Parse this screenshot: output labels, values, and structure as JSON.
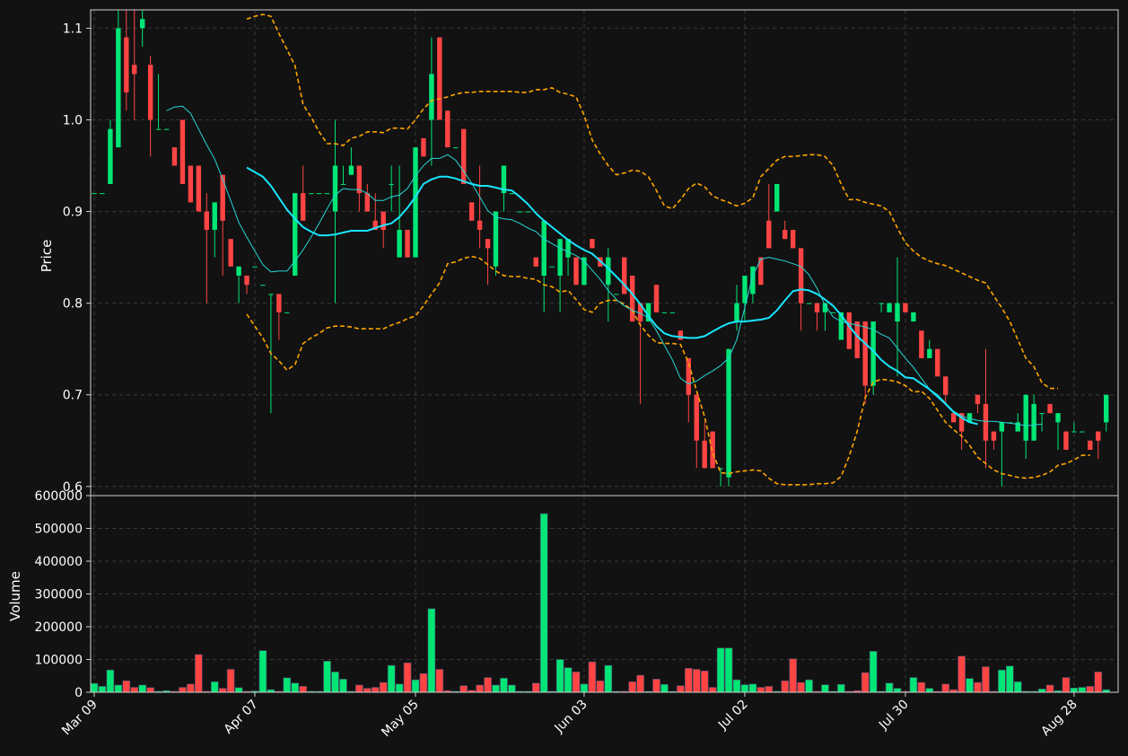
{
  "chart_data": {
    "type": "candlestick",
    "colors": {
      "background": "#121212",
      "up": "#00e676",
      "down": "#ff4444",
      "sma_fast": "#26d7d7",
      "sma_slow": "#18e6ff",
      "bands": "#ffa500",
      "grid": "#3a3a3a",
      "text": "#ffffff"
    },
    "xticks": [
      {
        "index": 0,
        "label": "Mar 09"
      },
      {
        "index": 20,
        "label": "Apr 07"
      },
      {
        "index": 40,
        "label": "May 05"
      },
      {
        "index": 61,
        "label": "Jun 03"
      },
      {
        "index": 81,
        "label": "Jul 02"
      },
      {
        "index": 101,
        "label": "Jul 30"
      },
      {
        "index": 122,
        "label": "Aug 28"
      }
    ],
    "price_panel": {
      "ylabel": "Price",
      "ylim": [
        0.59,
        1.12
      ],
      "yticks": [
        0.6,
        0.7,
        0.8,
        0.9,
        1.0,
        1.1
      ],
      "ytick_labels": [
        "0.6",
        "0.7",
        "0.8",
        "0.9",
        "1.0",
        "1.1"
      ]
    },
    "volume_panel": {
      "ylabel": "Volume",
      "ylim": [
        0,
        600000
      ],
      "yticks": [
        0,
        100000,
        200000,
        300000,
        400000,
        500000,
        600000
      ],
      "ytick_labels": [
        "0",
        "100000",
        "200000",
        "300000",
        "400000",
        "500000",
        "600000"
      ]
    },
    "candles": [
      [
        0.92,
        0.92,
        0.92,
        0.92
      ],
      [
        0.92,
        0.92,
        0.92,
        0.92
      ],
      [
        0.93,
        1.0,
        0.93,
        0.99
      ],
      [
        0.97,
        1.12,
        0.97,
        1.1
      ],
      [
        1.09,
        1.12,
        1.01,
        1.03
      ],
      [
        1.06,
        1.12,
        1.0,
        1.05
      ],
      [
        1.1,
        1.12,
        1.08,
        1.11
      ],
      [
        1.06,
        1.07,
        0.96,
        1.0
      ],
      [
        0.99,
        1.05,
        0.99,
        0.99
      ],
      [
        0.99,
        0.99,
        0.99,
        0.99
      ],
      [
        0.97,
        0.97,
        0.95,
        0.95
      ],
      [
        1.0,
        1.0,
        0.93,
        0.93
      ],
      [
        0.95,
        0.95,
        0.91,
        0.91
      ],
      [
        0.95,
        0.95,
        0.9,
        0.9
      ],
      [
        0.9,
        0.92,
        0.8,
        0.88
      ],
      [
        0.88,
        0.91,
        0.85,
        0.91
      ],
      [
        0.94,
        0.94,
        0.83,
        0.89
      ],
      [
        0.87,
        0.87,
        0.84,
        0.84
      ],
      [
        0.83,
        0.84,
        0.8,
        0.84
      ],
      [
        0.83,
        0.83,
        0.81,
        0.82
      ],
      [
        0.84,
        0.84,
        0.84,
        0.84
      ],
      [
        0.82,
        0.82,
        0.82,
        0.82
      ],
      [
        0.81,
        0.81,
        0.68,
        0.81
      ],
      [
        0.81,
        0.81,
        0.76,
        0.79
      ],
      [
        0.79,
        0.79,
        0.79,
        0.79
      ],
      [
        0.83,
        0.92,
        0.83,
        0.92
      ],
      [
        0.92,
        0.95,
        0.89,
        0.89
      ],
      [
        0.92,
        0.92,
        0.92,
        0.92
      ],
      [
        0.92,
        0.92,
        0.92,
        0.92
      ],
      [
        0.92,
        0.92,
        0.92,
        0.92
      ],
      [
        0.9,
        1.0,
        0.8,
        0.95
      ],
      [
        0.93,
        0.95,
        0.93,
        0.93
      ],
      [
        0.94,
        0.97,
        0.94,
        0.95
      ],
      [
        0.95,
        0.95,
        0.9,
        0.92
      ],
      [
        0.92,
        0.93,
        0.9,
        0.9
      ],
      [
        0.89,
        0.92,
        0.88,
        0.88
      ],
      [
        0.9,
        0.9,
        0.86,
        0.88
      ],
      [
        0.93,
        0.95,
        0.9,
        0.93
      ],
      [
        0.85,
        0.95,
        0.85,
        0.88
      ],
      [
        0.88,
        0.88,
        0.85,
        0.85
      ],
      [
        0.85,
        0.97,
        0.85,
        0.97
      ],
      [
        0.98,
        0.98,
        0.96,
        0.96
      ],
      [
        1.0,
        1.09,
        0.95,
        1.05
      ],
      [
        1.09,
        1.09,
        1.0,
        1.0
      ],
      [
        1.01,
        1.01,
        0.97,
        0.97
      ],
      [
        0.97,
        0.97,
        0.97,
        0.97
      ],
      [
        0.99,
        0.99,
        0.93,
        0.93
      ],
      [
        0.91,
        0.91,
        0.89,
        0.89
      ],
      [
        0.89,
        0.95,
        0.86,
        0.88
      ],
      [
        0.87,
        0.87,
        0.82,
        0.86
      ],
      [
        0.84,
        0.9,
        0.83,
        0.9
      ],
      [
        0.92,
        0.95,
        0.9,
        0.95
      ],
      [
        0.92,
        0.92,
        0.92,
        0.92
      ],
      [
        0.9,
        0.9,
        0.9,
        0.9
      ],
      [
        0.9,
        0.9,
        0.9,
        0.9
      ],
      [
        0.85,
        0.85,
        0.84,
        0.84
      ],
      [
        0.83,
        0.89,
        0.79,
        0.89
      ],
      [
        0.84,
        0.84,
        0.84,
        0.84
      ],
      [
        0.83,
        0.87,
        0.79,
        0.87
      ],
      [
        0.85,
        0.87,
        0.83,
        0.87
      ],
      [
        0.85,
        0.85,
        0.82,
        0.82
      ],
      [
        0.82,
        0.85,
        0.82,
        0.85
      ],
      [
        0.87,
        0.87,
        0.86,
        0.86
      ],
      [
        0.85,
        0.85,
        0.84,
        0.84
      ],
      [
        0.82,
        0.86,
        0.78,
        0.85
      ],
      [
        0.81,
        0.81,
        0.81,
        0.81
      ],
      [
        0.85,
        0.85,
        0.81,
        0.81
      ],
      [
        0.83,
        0.83,
        0.78,
        0.78
      ],
      [
        0.8,
        0.8,
        0.69,
        0.78
      ],
      [
        0.78,
        0.8,
        0.78,
        0.8
      ],
      [
        0.82,
        0.82,
        0.79,
        0.79
      ],
      [
        0.79,
        0.79,
        0.79,
        0.79
      ],
      [
        0.79,
        0.79,
        0.79,
        0.79
      ],
      [
        0.77,
        0.77,
        0.76,
        0.76
      ],
      [
        0.74,
        0.74,
        0.67,
        0.7
      ],
      [
        0.7,
        0.7,
        0.62,
        0.65
      ],
      [
        0.65,
        0.67,
        0.62,
        0.62
      ],
      [
        0.66,
        0.66,
        0.62,
        0.62
      ],
      [
        0.62,
        0.62,
        0.6,
        0.62
      ],
      [
        0.61,
        0.75,
        0.6,
        0.75
      ],
      [
        0.78,
        0.82,
        0.77,
        0.8
      ],
      [
        0.8,
        0.83,
        0.78,
        0.83
      ],
      [
        0.81,
        0.84,
        0.8,
        0.84
      ],
      [
        0.85,
        0.85,
        0.82,
        0.82
      ],
      [
        0.89,
        0.93,
        0.86,
        0.86
      ],
      [
        0.9,
        0.93,
        0.9,
        0.93
      ],
      [
        0.88,
        0.89,
        0.87,
        0.87
      ],
      [
        0.88,
        0.88,
        0.86,
        0.86
      ],
      [
        0.86,
        0.86,
        0.77,
        0.8
      ],
      [
        0.8,
        0.8,
        0.8,
        0.8
      ],
      [
        0.8,
        0.8,
        0.77,
        0.79
      ],
      [
        0.79,
        0.79,
        0.77,
        0.8
      ],
      [
        0.79,
        0.79,
        0.79,
        0.79
      ],
      [
        0.76,
        0.79,
        0.76,
        0.79
      ],
      [
        0.79,
        0.79,
        0.75,
        0.75
      ],
      [
        0.78,
        0.78,
        0.74,
        0.74
      ],
      [
        0.78,
        0.78,
        0.69,
        0.71
      ],
      [
        0.71,
        0.78,
        0.7,
        0.78
      ],
      [
        0.8,
        0.8,
        0.79,
        0.8
      ],
      [
        0.79,
        0.8,
        0.79,
        0.8
      ],
      [
        0.78,
        0.85,
        0.72,
        0.8
      ],
      [
        0.8,
        0.8,
        0.79,
        0.79
      ],
      [
        0.78,
        0.79,
        0.78,
        0.79
      ],
      [
        0.77,
        0.77,
        0.74,
        0.74
      ],
      [
        0.74,
        0.76,
        0.74,
        0.75
      ],
      [
        0.75,
        0.75,
        0.72,
        0.72
      ],
      [
        0.72,
        0.72,
        0.69,
        0.7
      ],
      [
        0.68,
        0.68,
        0.67,
        0.67
      ],
      [
        0.68,
        0.68,
        0.64,
        0.66
      ],
      [
        0.67,
        0.68,
        0.67,
        0.68
      ],
      [
        0.7,
        0.7,
        0.68,
        0.69
      ],
      [
        0.69,
        0.75,
        0.62,
        0.65
      ],
      [
        0.66,
        0.66,
        0.64,
        0.65
      ],
      [
        0.66,
        0.67,
        0.6,
        0.67
      ],
      [
        0.67,
        0.67,
        0.67,
        0.67
      ],
      [
        0.66,
        0.68,
        0.66,
        0.67
      ],
      [
        0.65,
        0.7,
        0.63,
        0.7
      ],
      [
        0.65,
        0.7,
        0.65,
        0.69
      ],
      [
        0.68,
        0.68,
        0.66,
        0.68
      ],
      [
        0.69,
        0.69,
        0.68,
        0.68
      ],
      [
        0.67,
        0.68,
        0.64,
        0.68
      ],
      [
        0.66,
        0.66,
        0.64,
        0.64
      ],
      [
        0.66,
        0.67,
        0.66,
        0.66
      ],
      [
        0.66,
        0.66,
        0.66,
        0.66
      ],
      [
        0.65,
        0.65,
        0.64,
        0.64
      ],
      [
        0.66,
        0.66,
        0.63,
        0.65
      ],
      [
        0.67,
        0.7,
        0.66,
        0.7
      ]
    ],
    "volumes": [
      27000,
      18000,
      68000,
      22000,
      35000,
      15000,
      22000,
      14000,
      3000,
      5000,
      3000,
      15000,
      25000,
      115000,
      3000,
      32000,
      12000,
      70000,
      14000,
      3000,
      4000,
      127000,
      8000,
      3000,
      44000,
      28000,
      18000,
      3000,
      3000,
      95000,
      62000,
      40000,
      3000,
      22000,
      12000,
      15000,
      30000,
      82000,
      25000,
      90000,
      38000,
      57000,
      255000,
      70000,
      5000,
      3000,
      20000,
      6000,
      22000,
      45000,
      22000,
      43000,
      22000,
      3000,
      3000,
      28000,
      545000,
      3000,
      100000,
      75000,
      62000,
      25000,
      93000,
      35000,
      82000,
      3000,
      3000,
      32000,
      52000,
      3000,
      40000,
      24000,
      3000,
      20000,
      73000,
      70000,
      65000,
      15000,
      135000,
      135000,
      38000,
      23000,
      25000,
      15000,
      18000,
      3000,
      35000,
      102000,
      30000,
      38000,
      3000,
      23000,
      3000,
      24000,
      3000,
      5000,
      60000,
      125000,
      3000,
      28000,
      12000,
      3000,
      45000,
      30000,
      12000,
      3000,
      25000,
      8000,
      110000,
      42000,
      30000,
      78000,
      3000,
      68000,
      80000,
      32000,
      3000,
      3000,
      10000,
      22000,
      5000,
      45000,
      13000,
      15000,
      18000,
      62000,
      8000
    ],
    "sma_fast": {
      "start": 9,
      "values": [
        1.01,
        1.014,
        1.015,
        1.007,
        0.99,
        0.973,
        0.957,
        0.935,
        0.912,
        0.888,
        0.872,
        0.857,
        0.842,
        0.834,
        0.835,
        0.835,
        0.846,
        0.858,
        0.872,
        0.887,
        0.903,
        0.918,
        0.925,
        0.924,
        0.924,
        0.92,
        0.912,
        0.912,
        0.916,
        0.918,
        0.925,
        0.939,
        0.95,
        0.958,
        0.958,
        0.962,
        0.956,
        0.944,
        0.931,
        0.916,
        0.901,
        0.894,
        0.892,
        0.891,
        0.887,
        0.882,
        0.878,
        0.87,
        0.865,
        0.86,
        0.856,
        0.852,
        0.846,
        0.836,
        0.826,
        0.814,
        0.804,
        0.797,
        0.792,
        0.789,
        0.784,
        0.77,
        0.754,
        0.738,
        0.718,
        0.712,
        0.715,
        0.721,
        0.726,
        0.732,
        0.74,
        0.76,
        0.795,
        0.83,
        0.848,
        0.85,
        0.848,
        0.846,
        0.843,
        0.84,
        0.831,
        0.816,
        0.798,
        0.785,
        0.78,
        0.778,
        0.776,
        0.774,
        0.771,
        0.766,
        0.762,
        0.751,
        0.74,
        0.73,
        0.718,
        0.706,
        0.7,
        0.691,
        0.682,
        0.677,
        0.674,
        0.672,
        0.671,
        0.671,
        0.67,
        0.669,
        0.668,
        0.666,
        0.667,
        0.668
      ]
    },
    "sma_slow": {
      "start": 19,
      "values": [
        0.948,
        0.943,
        0.938,
        0.928,
        0.915,
        0.902,
        0.892,
        0.883,
        0.878,
        0.874,
        0.874,
        0.875,
        0.877,
        0.879,
        0.879,
        0.879,
        0.882,
        0.885,
        0.887,
        0.894,
        0.904,
        0.916,
        0.93,
        0.935,
        0.938,
        0.938,
        0.936,
        0.933,
        0.93,
        0.928,
        0.928,
        0.926,
        0.924,
        0.923,
        0.916,
        0.908,
        0.898,
        0.89,
        0.883,
        0.876,
        0.869,
        0.863,
        0.858,
        0.854,
        0.846,
        0.838,
        0.829,
        0.82,
        0.81,
        0.799,
        0.786,
        0.775,
        0.767,
        0.764,
        0.763,
        0.762,
        0.762,
        0.764,
        0.769,
        0.774,
        0.778,
        0.78,
        0.78,
        0.781,
        0.782,
        0.784,
        0.792,
        0.803,
        0.813,
        0.815,
        0.814,
        0.81,
        0.804,
        0.797,
        0.787,
        0.775,
        0.764,
        0.756,
        0.748,
        0.738,
        0.731,
        0.726,
        0.719,
        0.718,
        0.712,
        0.706,
        0.698,
        0.69,
        0.681,
        0.675,
        0.67,
        0.668
      ]
    },
    "band_upper": {
      "start": 19,
      "values": [
        1.11,
        1.113,
        1.115,
        1.113,
        1.094,
        1.077,
        1.059,
        1.017,
        1.003,
        0.987,
        0.974,
        0.974,
        0.972,
        0.98,
        0.982,
        0.987,
        0.987,
        0.986,
        0.991,
        0.991,
        0.99,
        1.0,
        1.012,
        1.021,
        1.023,
        1.025,
        1.028,
        1.03,
        1.03,
        1.031,
        1.031,
        1.031,
        1.031,
        1.031,
        1.03,
        1.03,
        1.033,
        1.033,
        1.035,
        1.03,
        1.028,
        1.025,
        1.005,
        0.978,
        0.963,
        0.95,
        0.94,
        0.942,
        0.945,
        0.944,
        0.938,
        0.923,
        0.906,
        0.903,
        0.913,
        0.925,
        0.931,
        0.927,
        0.917,
        0.913,
        0.91,
        0.906,
        0.909,
        0.915,
        0.938,
        0.947,
        0.956,
        0.96,
        0.96,
        0.961,
        0.962,
        0.962,
        0.96,
        0.95,
        0.93,
        0.913,
        0.913,
        0.91,
        0.908,
        0.906,
        0.9,
        0.882,
        0.866,
        0.857,
        0.85,
        0.846,
        0.843,
        0.841,
        0.837,
        0.833,
        0.829,
        0.825,
        0.822,
        0.808,
        0.795,
        0.78,
        0.76,
        0.74,
        0.731,
        0.713,
        0.707,
        0.707
      ]
    },
    "band_lower": {
      "start": 19,
      "values": [
        0.788,
        0.775,
        0.762,
        0.745,
        0.737,
        0.727,
        0.733,
        0.756,
        0.762,
        0.767,
        0.773,
        0.775,
        0.775,
        0.774,
        0.772,
        0.772,
        0.772,
        0.772,
        0.776,
        0.779,
        0.783,
        0.786,
        0.797,
        0.81,
        0.822,
        0.843,
        0.845,
        0.849,
        0.851,
        0.849,
        0.842,
        0.835,
        0.83,
        0.829,
        0.829,
        0.827,
        0.826,
        0.82,
        0.818,
        0.812,
        0.814,
        0.804,
        0.793,
        0.79,
        0.8,
        0.803,
        0.803,
        0.799,
        0.792,
        0.776,
        0.765,
        0.757,
        0.756,
        0.756,
        0.755,
        0.735,
        0.704,
        0.676,
        0.637,
        0.615,
        0.614,
        0.616,
        0.617,
        0.618,
        0.617,
        0.609,
        0.603,
        0.602,
        0.602,
        0.602,
        0.602,
        0.603,
        0.603,
        0.604,
        0.611,
        0.633,
        0.66,
        0.697,
        0.714,
        0.717,
        0.716,
        0.714,
        0.71,
        0.703,
        0.704,
        0.696,
        0.683,
        0.67,
        0.662,
        0.655,
        0.645,
        0.632,
        0.625,
        0.618,
        0.614,
        0.612,
        0.61,
        0.609,
        0.61,
        0.612,
        0.616,
        0.623,
        0.625,
        0.629,
        0.634,
        0.634
      ]
    }
  }
}
